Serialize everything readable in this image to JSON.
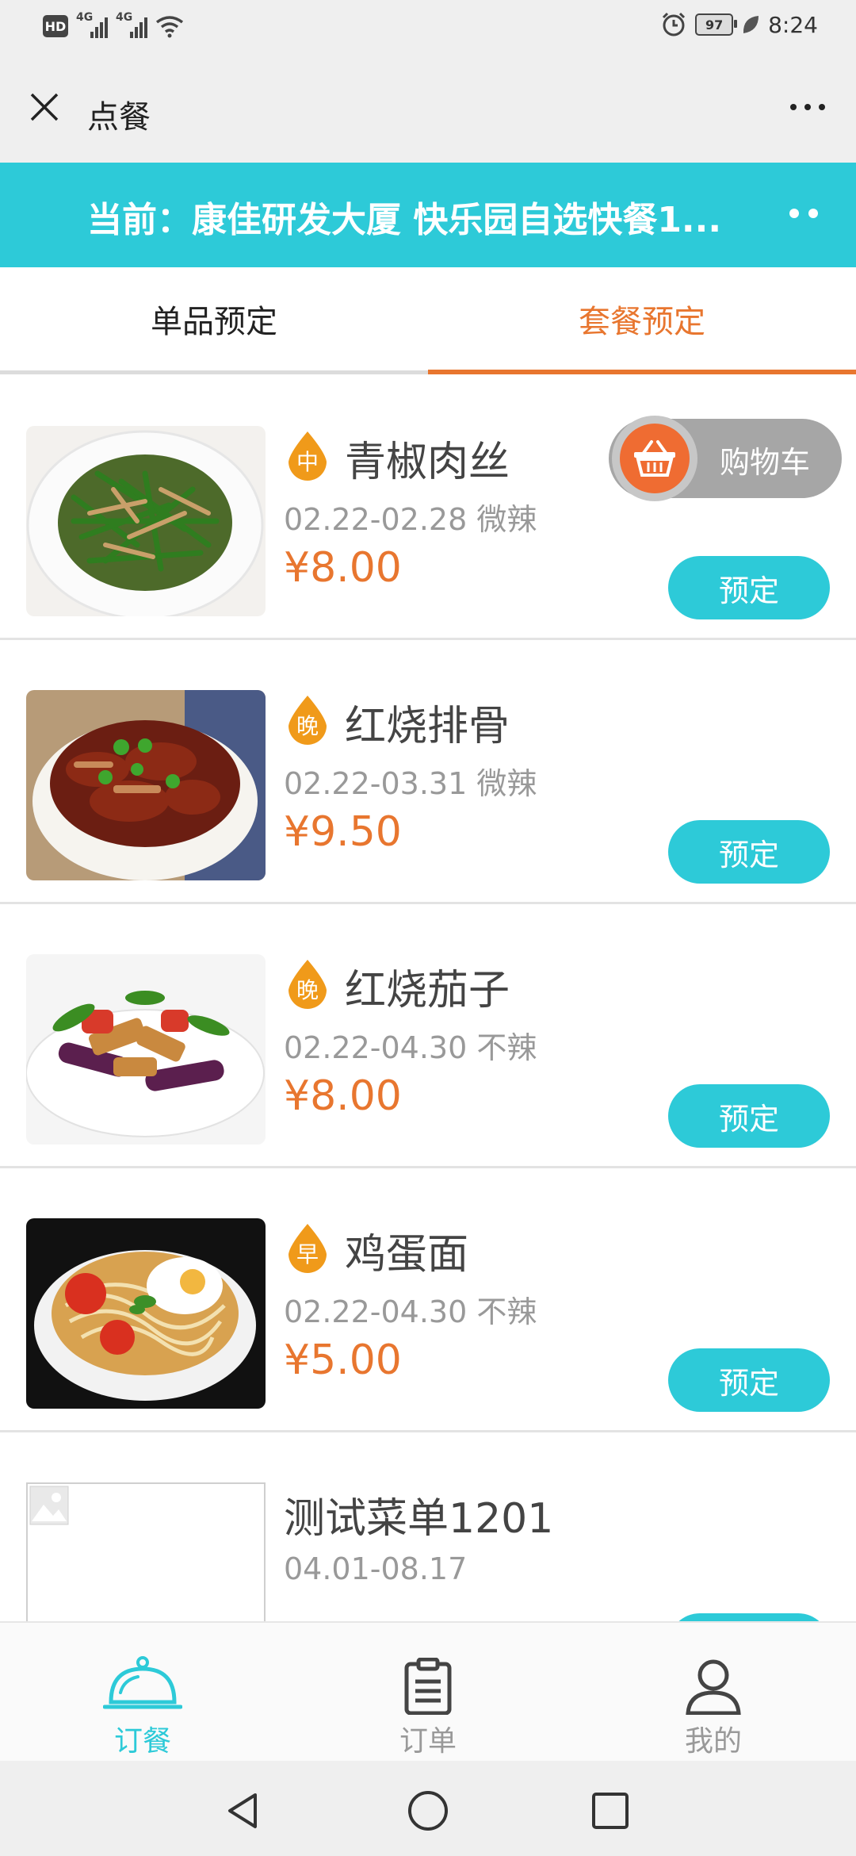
{
  "status_bar": {
    "hd": "HD",
    "signal1_label": "4G",
    "signal2_label": "4G",
    "battery": "97",
    "time": "8:24"
  },
  "title_bar": {
    "title": "点餐"
  },
  "location": {
    "text": "当前：康佳研发大厦 快乐园自选快餐1..."
  },
  "tabs": [
    {
      "label": "单品预定",
      "active": false
    },
    {
      "label": "套餐预定",
      "active": true
    }
  ],
  "cart": {
    "label": "购物车"
  },
  "items": [
    {
      "badge": "中",
      "name": "青椒肉丝",
      "meta": "02.22-02.28 微辣",
      "price": "¥8.00",
      "button": "预定"
    },
    {
      "badge": "晚",
      "name": "红烧排骨",
      "meta": "02.22-03.31 微辣",
      "price": "¥9.50",
      "button": "预定"
    },
    {
      "badge": "晚",
      "name": "红烧茄子",
      "meta": "02.22-04.30 不辣",
      "price": "¥8.00",
      "button": "预定"
    },
    {
      "badge": "早",
      "name": "鸡蛋面",
      "meta": "02.22-04.30 不辣",
      "price": "¥5.00",
      "button": "预定"
    },
    {
      "name": "测试菜单1201",
      "meta": "04.01-08.17"
    }
  ],
  "bottom_nav": [
    {
      "label": "订餐",
      "icon": "cloche-icon",
      "active": true
    },
    {
      "label": "订单",
      "icon": "clipboard-icon",
      "active": false
    },
    {
      "label": "我的",
      "icon": "user-icon",
      "active": false
    }
  ],
  "colors": {
    "accent_teal": "#2dcad8",
    "accent_orange": "#e8762f"
  }
}
